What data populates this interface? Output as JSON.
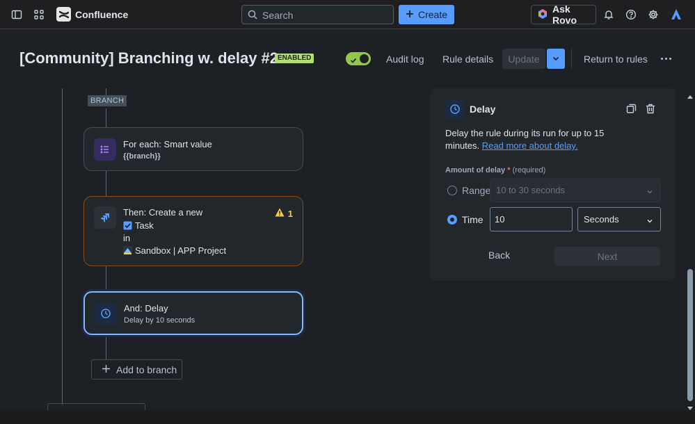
{
  "topnav": {
    "app_name": "Confluence",
    "search_placeholder": "Search",
    "create_label": "Create",
    "ask_rovo_label": "Ask Rovo"
  },
  "header": {
    "title": "[Community] Branching w. delay #2",
    "status_badge": "ENABLED",
    "audit_log": "Audit log",
    "rule_details": "Rule details",
    "update": "Update",
    "return_to_rules": "Return to rules"
  },
  "canvas": {
    "branch_tag": "BRANCH",
    "cards": [
      {
        "title": "For each: Smart value",
        "subtitle": "{{branch}}"
      },
      {
        "title": "Then: Create a new",
        "issue_type": "Task",
        "in_label": "in",
        "project": "Sandbox | APP Project",
        "warning_count": "1"
      },
      {
        "title": "And: Delay",
        "subtitle": "Delay by 10 seconds"
      }
    ],
    "add_to_branch": "Add to branch"
  },
  "panel": {
    "title": "Delay",
    "description": "Delay the rule during its run for up to 15 minutes.",
    "link_text": "Read more about delay.",
    "field_label": "Amount of delay",
    "required_mark": "*",
    "required_text": "(required)",
    "range_label": "Range",
    "range_value": "10 to 30 seconds",
    "time_label": "Time",
    "time_value": "10",
    "unit_value": "Seconds",
    "selected_option": "Time",
    "back_label": "Back",
    "next_label": "Next"
  },
  "colors": {
    "accent": "#579dff",
    "enabled_green": "#94c748",
    "warning": "#f5cd47",
    "card_border_warning": "#8f4a15",
    "card_border_selected": "#85b8ff"
  }
}
